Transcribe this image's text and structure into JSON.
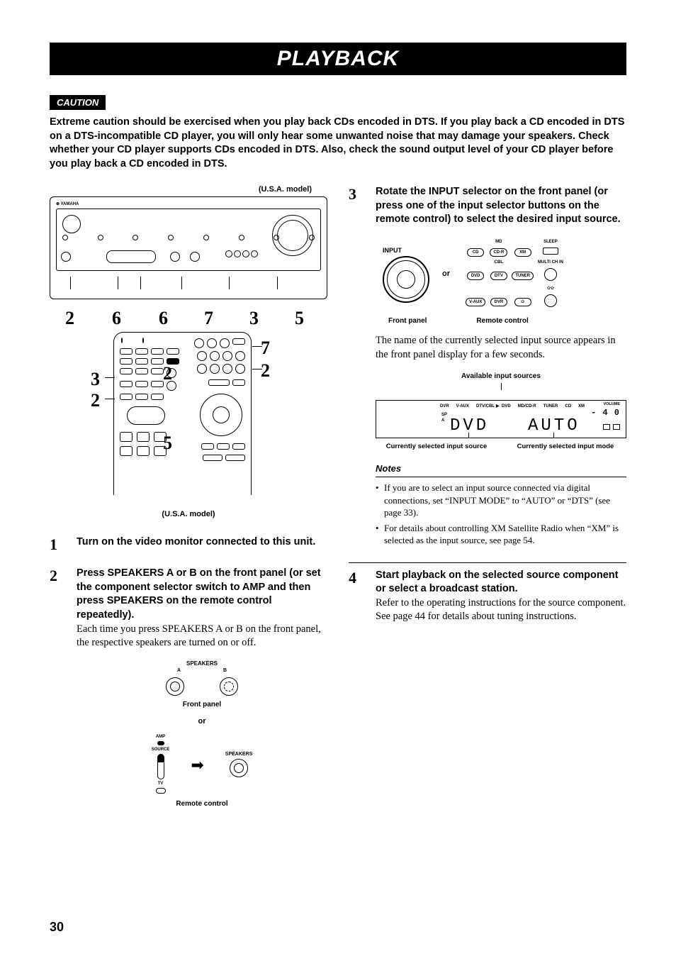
{
  "chapter_title": "PLAYBACK",
  "page_number": "30",
  "caution": {
    "label": "CAUTION",
    "text": "Extreme caution should be exercised when you play back CDs encoded in DTS. If you play back a CD encoded in DTS on a DTS-incompatible CD player, you will only hear some unwanted noise that may damage your speakers. Check whether your CD player supports CDs encoded in DTS. Also, check the sound output level of your CD player before you play back a CD encoded in DTS."
  },
  "model_note": "(U.S.A. model)",
  "front_panel_callouts": [
    "2",
    "6",
    "6",
    "7",
    "3",
    "5"
  ],
  "remote_callouts": {
    "left": [
      "3",
      "2"
    ],
    "middle": [
      "2",
      "5"
    ],
    "right": [
      "7",
      "2"
    ]
  },
  "steps": {
    "s1": {
      "num": "1",
      "bold": "Turn on the video monitor connected to this unit."
    },
    "s2": {
      "num": "2",
      "bold": "Press SPEAKERS A or B on the front panel (or set the component selector switch to AMP and then press SPEAKERS on the remote control repeatedly).",
      "body": "Each time you press SPEAKERS A or B on the front panel, the respective speakers are turned on or off."
    },
    "s3": {
      "num": "3",
      "bold": "Rotate the INPUT selector on the front panel (or press one of the input selector buttons on the remote control) to select the desired input source.",
      "body": "The name of the currently selected input source appears in the front panel display for a few seconds."
    },
    "s4": {
      "num": "4",
      "bold": "Start playback on the selected source component or select a broadcast station.",
      "body1": "Refer to the operating instructions for the source component.",
      "body2": "See page 44 for details about tuning instructions."
    }
  },
  "speakers_fig": {
    "title": "SPEAKERS",
    "a": "A",
    "b": "B",
    "caption": "Front panel",
    "or": "or",
    "caption2": "Remote control",
    "amp": "AMP",
    "source": "SOURCE",
    "tv": "TV",
    "speakers": "SPEAKERS"
  },
  "input_fig": {
    "input_label": "INPUT",
    "or": "or",
    "rc_rows": [
      [
        "",
        "MD",
        "",
        "SLEEP"
      ],
      [
        "CD",
        "CD-R",
        "XM",
        ""
      ],
      [
        "",
        "CBL",
        "",
        "MULTI CH IN"
      ],
      [
        "DVD",
        "DTV",
        "TUNER",
        ""
      ],
      [
        "",
        "",
        "",
        "✩✩"
      ],
      [
        "V-AUX",
        "DVR",
        "✩",
        ""
      ]
    ],
    "caption_front": "Front panel",
    "caption_remote": "Remote control"
  },
  "lcd": {
    "avail_label": "Available input sources",
    "top_sources": [
      "DVR",
      "V-AUX",
      "DTV/CBL",
      "DVD",
      "MD/CD-R",
      "TUNER",
      "CD",
      "XM"
    ],
    "selected_src": "DVD",
    "sp": "SP\nA",
    "seg_left": "DVD",
    "seg_right": "AUTO",
    "volume_label": "VOLUME",
    "volume_value": "- 4 0",
    "cap_left": "Currently selected input source",
    "cap_right": "Currently selected input mode"
  },
  "notes": {
    "heading": "Notes",
    "items": [
      "If you are to select an input source connected via digital connections, set “INPUT MODE” to “AUTO” or “DTS” (see page 33).",
      "For details about controlling XM Satellite Radio when “XM” is selected as the input source, see page 54."
    ]
  }
}
